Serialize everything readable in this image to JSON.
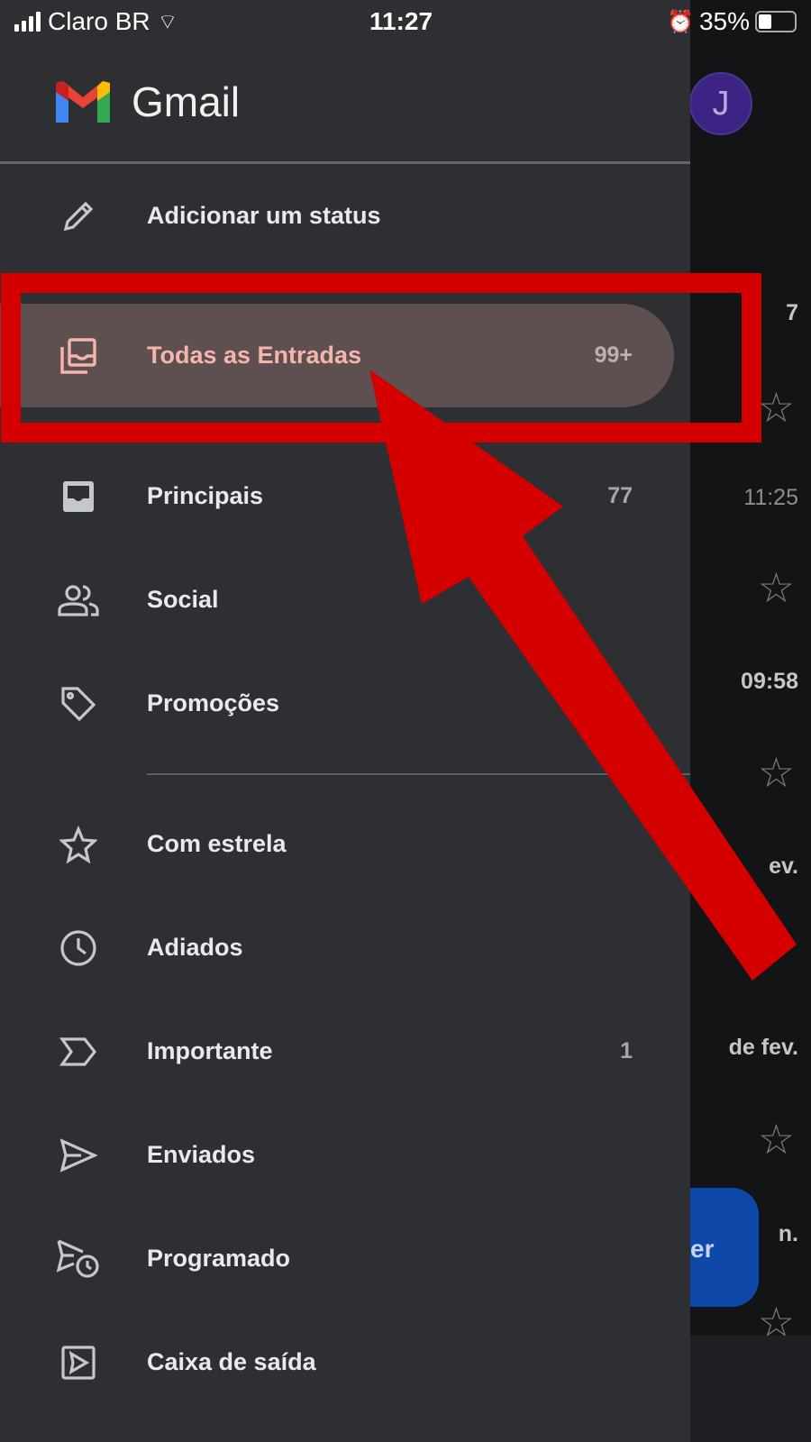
{
  "status_bar": {
    "carrier": "Claro BR",
    "time": "11:27",
    "battery": "35%"
  },
  "app": {
    "name": "Gmail",
    "avatar_initial": "J"
  },
  "drawer": {
    "status_item": "Adicionar um status",
    "items": [
      {
        "label": "Todas as Entradas",
        "count": "99+",
        "selected": true
      },
      {
        "label": "Principais",
        "count": "77"
      },
      {
        "label": "Social",
        "count": ""
      },
      {
        "label": "Promoções",
        "count": ""
      },
      {
        "label": "Com estrela",
        "count": ""
      },
      {
        "label": "Adiados",
        "count": ""
      },
      {
        "label": "Importante",
        "count": "1"
      },
      {
        "label": "Enviados",
        "count": ""
      },
      {
        "label": "Programado",
        "count": ""
      },
      {
        "label": "Caixa de saída",
        "count": ""
      }
    ]
  },
  "background_list": {
    "fragments": [
      "7",
      "11:25",
      "09:58",
      "ev.",
      "de fev.",
      "n."
    ],
    "fab_fragment": "er"
  },
  "annotation": {
    "color": "#d40000"
  }
}
